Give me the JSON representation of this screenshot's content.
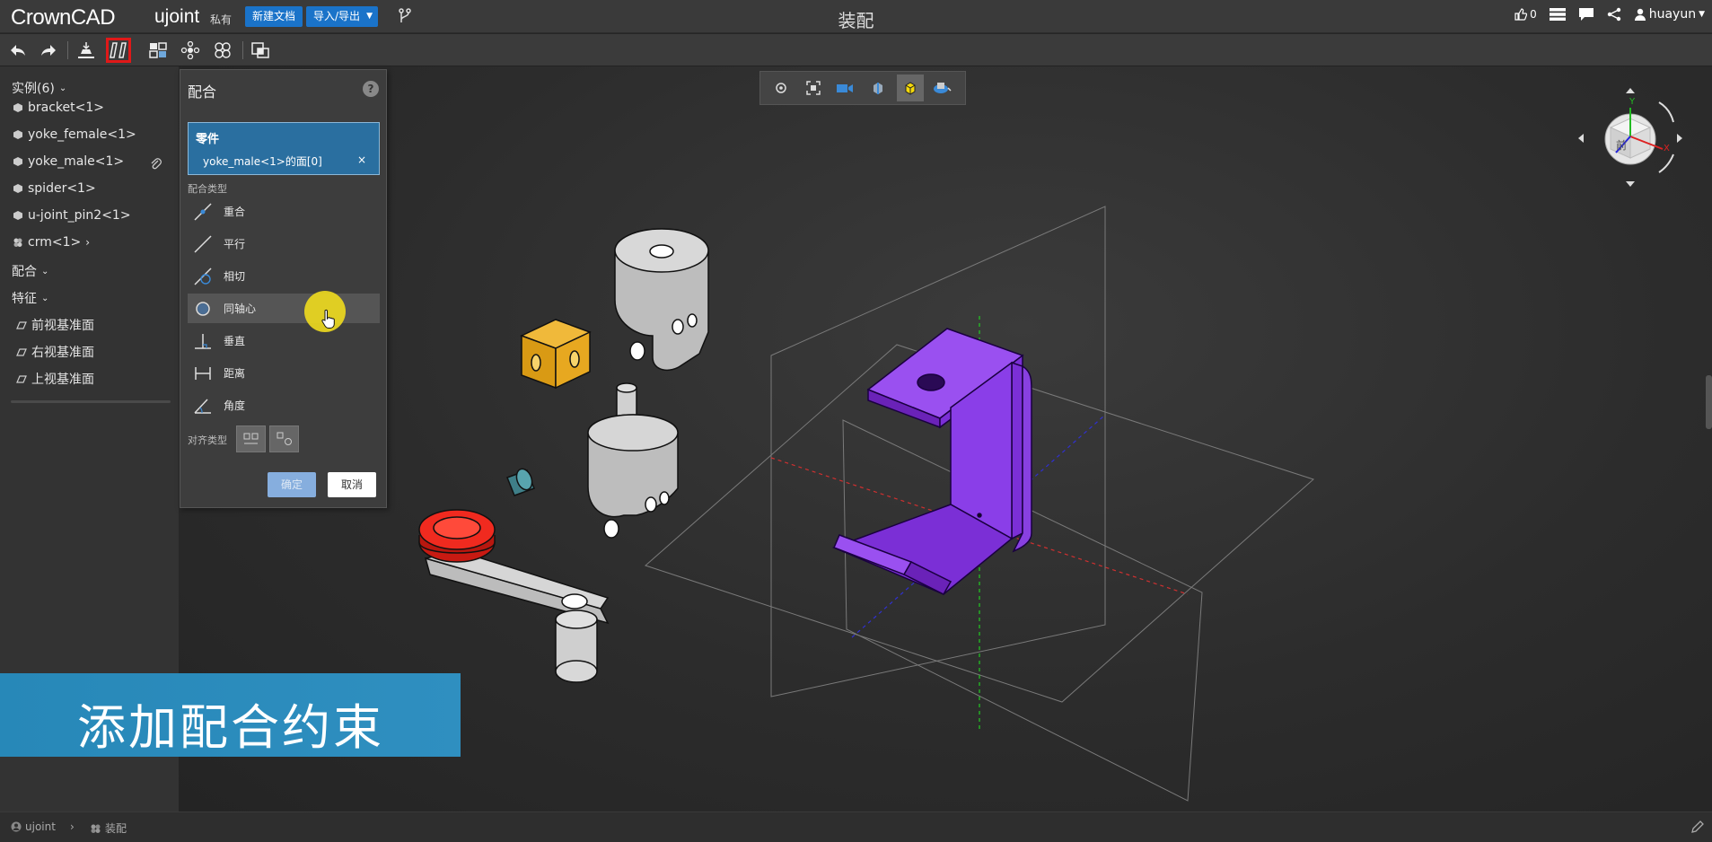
{
  "app": {
    "logo": "CrownCAD",
    "doc_name": "ujoint",
    "doc_tag": "私有",
    "page_title": "装配"
  },
  "header": {
    "new_doc_label": "新建文档",
    "import_export_label": "导入/导出",
    "like_count": "0",
    "user_name": "huayun"
  },
  "tree": {
    "instances_label": "实例(6)",
    "items": [
      {
        "label": "bracket<1>"
      },
      {
        "label": "yoke_female<1>"
      },
      {
        "label": "yoke_male<1>"
      },
      {
        "label": "spider<1>"
      },
      {
        "label": "u-joint_pin2<1>"
      },
      {
        "label": "crm<1>"
      }
    ],
    "mates_label": "配合",
    "features_label": "特征",
    "planes": [
      {
        "label": "前视基准面"
      },
      {
        "label": "右视基准面"
      },
      {
        "label": "上视基准面"
      }
    ]
  },
  "mate_panel": {
    "title": "配合",
    "help": "?",
    "part_label": "零件",
    "part_value": "yoke_male<1>的面[0]",
    "part_remove": "×",
    "mate_type_label": "配合类型",
    "types": [
      {
        "label": "重合"
      },
      {
        "label": "平行"
      },
      {
        "label": "相切"
      },
      {
        "label": "同轴心"
      },
      {
        "label": "垂直"
      },
      {
        "label": "距离"
      },
      {
        "label": "角度"
      }
    ],
    "align_label": "对齐类型",
    "ok_label": "确定",
    "cancel_label": "取消"
  },
  "caption": {
    "text": "添加配合约束"
  },
  "status": {
    "doc": "ujoint",
    "view": "装配"
  },
  "colors": {
    "accent": "#1a73c9",
    "bracket": "#7b2fd6",
    "cube": "#e3a514",
    "knob": "#e0261c",
    "caption_bg": "#2788b8"
  }
}
